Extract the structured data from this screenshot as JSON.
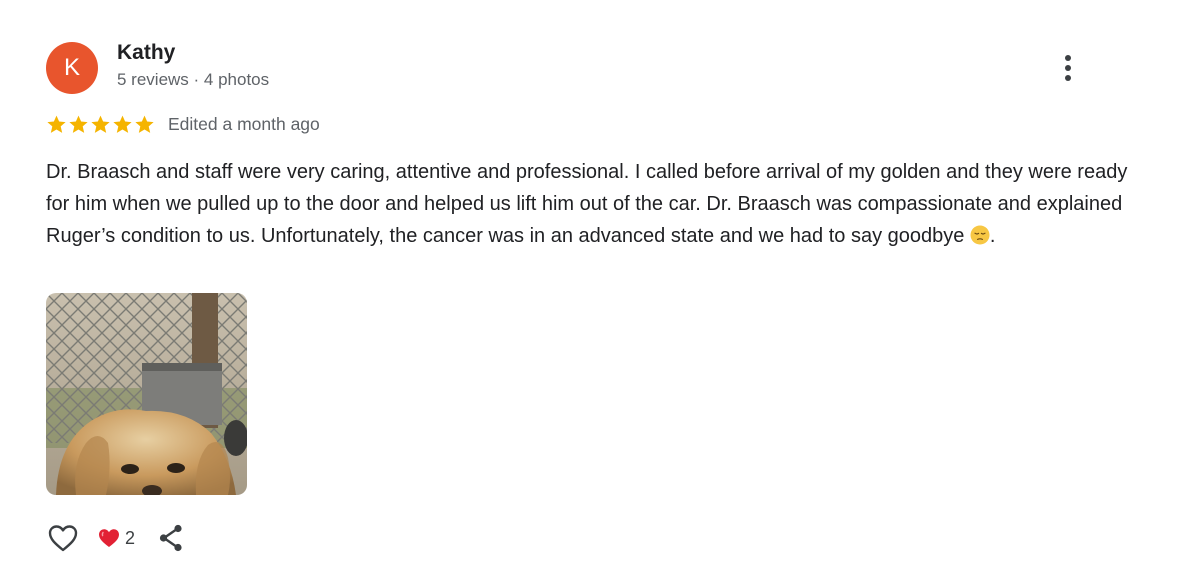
{
  "reviewer": {
    "initial": "K",
    "name": "Kathy",
    "meta": "5 reviews · 4 photos",
    "avatar_color": "#e8552d"
  },
  "rating": {
    "stars": 5,
    "max_stars": 5,
    "star_color": "#f5b400",
    "timestamp": "Edited a month ago"
  },
  "review": {
    "text": "Dr. Braasch and staff were very caring, attentive and professional. I called before arrival of my golden and they were ready for him when we pulled up to the door and helped us lift him out of the car. Dr. Braasch was compassionate and explained Ruger’s condition to us. Unfortunately, the cancer was in an advanced state and we had to say goodbye ",
    "text_end": ".",
    "emoji": "pensive-face-emoji"
  },
  "photo": {
    "subject": "golden-retriever-photo"
  },
  "actions": {
    "like_icon": "heart-outline-icon",
    "reaction_icon": "red-heart-icon",
    "reaction_count": "2",
    "share_icon": "share-icon",
    "menu_icon": "more-vert-icon"
  }
}
